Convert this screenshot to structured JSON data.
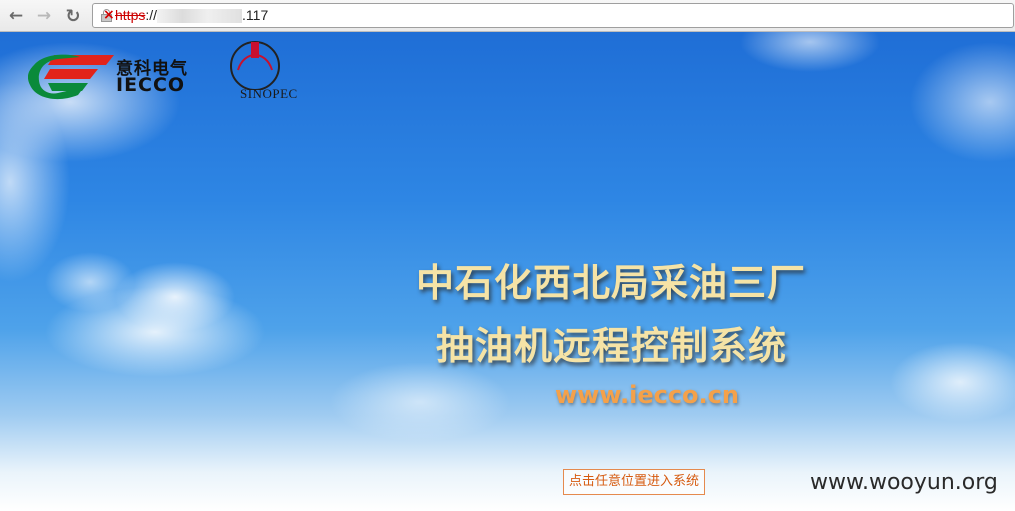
{
  "browser": {
    "back_icon": "arrow-left-icon",
    "forward_icon": "arrow-right-icon",
    "reload_icon": "reload-icon",
    "security_icon": "insecure-lock-icon",
    "url_scheme": "https",
    "url_prefix": "://",
    "url_suffix": ".117"
  },
  "logos": {
    "iecco_cn": "意科电气",
    "iecco_en": "IECCO",
    "sinopec_text": "SINOPEC"
  },
  "main": {
    "title_line1": "中石化西北局采油三厂",
    "title_line2": "抽油机远程控制系统",
    "website": "www.iecco.cn",
    "enter_button": "点击任意位置进入系统"
  },
  "watermark": "www.wooyun.org",
  "colors": {
    "sky_top": "#1f6ed6",
    "title_text": "#f5e3a6",
    "website_text": "#f4a14a",
    "button_border": "#e58a4e",
    "iecco_red": "#e2231a",
    "iecco_green": "#0a8a3a",
    "sinopec_red": "#c8102e"
  }
}
